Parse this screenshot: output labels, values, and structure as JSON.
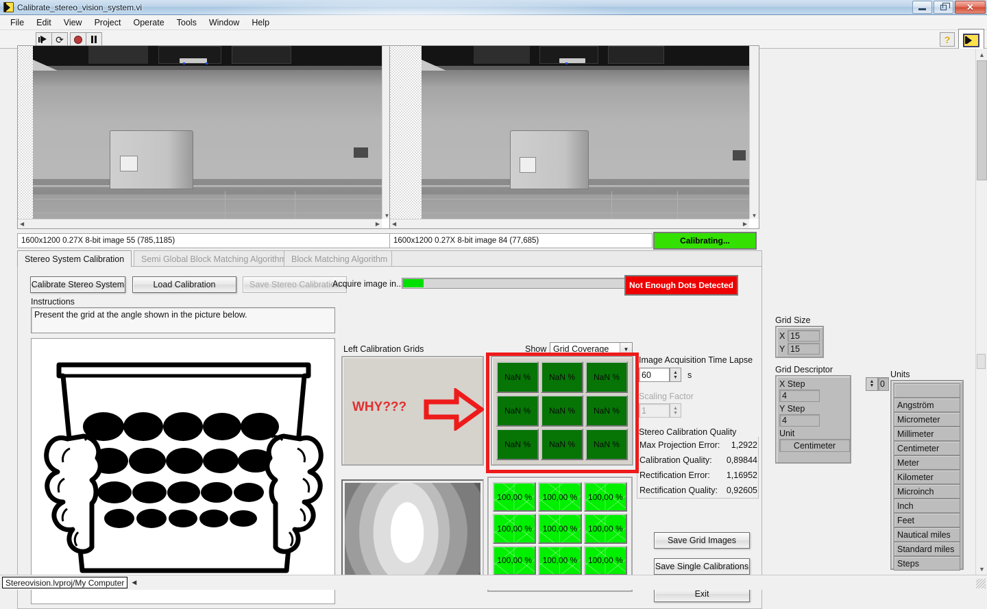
{
  "window": {
    "title": "Calibrate_stereo_vision_system.vi",
    "icon": "labview-vi-icon",
    "controls": {
      "minimize": "minimize-icon",
      "restore": "restore-icon",
      "close": "✕"
    }
  },
  "menubar": {
    "items": [
      "File",
      "Edit",
      "View",
      "Project",
      "Operate",
      "Tools",
      "Window",
      "Help"
    ]
  },
  "toolbar": {
    "buttons": [
      {
        "name": "run-button",
        "icon": "run-arrow-icon"
      },
      {
        "name": "run-continuously-button",
        "icon": "continuous-run-icon"
      },
      {
        "name": "abort-button",
        "icon": "abort-execution-icon"
      },
      {
        "name": "pause-button",
        "icon": "pause-icon"
      }
    ],
    "help_icon": "?",
    "vi_icon": "vi-monitor-icon"
  },
  "images": {
    "left": {
      "info": "1600x1200 0.27X 8-bit image 55   (785,1185)"
    },
    "right": {
      "info": "1600x1200 0.27X 8-bit image 84   (77,685)"
    },
    "status_led": {
      "label": "Calibrating...",
      "color": "#34e000",
      "text_color": "#000000"
    }
  },
  "tabs": [
    {
      "label": "Stereo System Calibration",
      "active": true
    },
    {
      "label": "Semi Global Block Matching Algorithm",
      "active": false
    },
    {
      "label": "Block Matching Algorithm",
      "active": false
    }
  ],
  "actions": {
    "calibrate": "Calibrate Stereo System",
    "load": "Load Calibration",
    "save_stereo": "Save Stereo Calibration",
    "save_stereo_disabled": true,
    "acquire_label": "Acquire image in...",
    "acquire_progress_pct": 9,
    "alert": {
      "label": "Not Enough Dots Detected",
      "color": "#ee0000",
      "text_color": "#ffffff"
    }
  },
  "instructions": {
    "title": "Instructions",
    "text": "Present the grid at the angle shown in the picture below.",
    "picture_alt": "hands-holding-dot-grid-illustration",
    "grid_rows": 4,
    "grid_cols": 5
  },
  "grids_panel": {
    "title": "Left Calibration Grids",
    "show_label": "Show",
    "show_value": "Grid Coverage",
    "annotation": {
      "text": "WHY???",
      "color": "#e03030",
      "arrow": "right-arrow-annotation"
    },
    "top_matrix": {
      "rows": 3,
      "cols": 3,
      "values": [
        [
          "NaN %",
          "NaN %",
          "NaN %"
        ],
        [
          "NaN %",
          "NaN %",
          "NaN %"
        ],
        [
          "NaN %",
          "NaN %",
          "NaN %"
        ]
      ],
      "cell_color": "#067506",
      "highlighted": true
    },
    "bottom_matrix": {
      "rows": 3,
      "cols": 3,
      "values": [
        [
          "100,00 %",
          "100,00 %",
          "100,00 %"
        ],
        [
          "100,00 %",
          "100,00 %",
          "100,00 %"
        ],
        [
          "100,00 %",
          "100,00 %",
          "100,00 %"
        ]
      ],
      "cell_color": "#00f000",
      "highlighted": false
    }
  },
  "settings": {
    "time_lapse_label": "Image Acquisition Time Lapse",
    "time_lapse_value": "60",
    "time_lapse_unit": "s",
    "scaling_factor_label": "Scaling Factor",
    "scaling_factor_value": "1",
    "scaling_factor_disabled": true
  },
  "quality": {
    "title": "Stereo Calibration Quality",
    "rows": [
      {
        "label": "Max Projection Error:",
        "value": "1,2922"
      },
      {
        "label": "Calibration Quality:",
        "value": "0,89844"
      },
      {
        "label": "Rectification Error:",
        "value": "1,16952"
      },
      {
        "label": "Rectification Quality:",
        "value": "0,92605"
      }
    ]
  },
  "bottom_buttons": {
    "save_grid_images": "Save Grid Images",
    "save_single_calibrations": "Save Single Calibrations",
    "exit": "Exit"
  },
  "grid_size": {
    "title": "Grid Size",
    "x_label": "X",
    "x_value": "15",
    "y_label": "Y",
    "y_value": "15"
  },
  "grid_descriptor": {
    "title": "Grid Descriptor",
    "x_step_label": "X Step",
    "x_step_value": "4",
    "y_step_label": "Y Step",
    "y_step_value": "4",
    "unit_label": "Unit",
    "unit_value": "Centimeter"
  },
  "units": {
    "title": "Units",
    "index_value": "0",
    "items": [
      "",
      "Angström",
      "Micrometer",
      "Millimeter",
      "Centimeter",
      "Meter",
      "Kilometer",
      "Microinch",
      "Inch",
      "Feet",
      "Nautical miles",
      "Standard miles",
      "Steps"
    ]
  },
  "statusbar": {
    "project": "Stereovision.lvproj/My Computer"
  }
}
